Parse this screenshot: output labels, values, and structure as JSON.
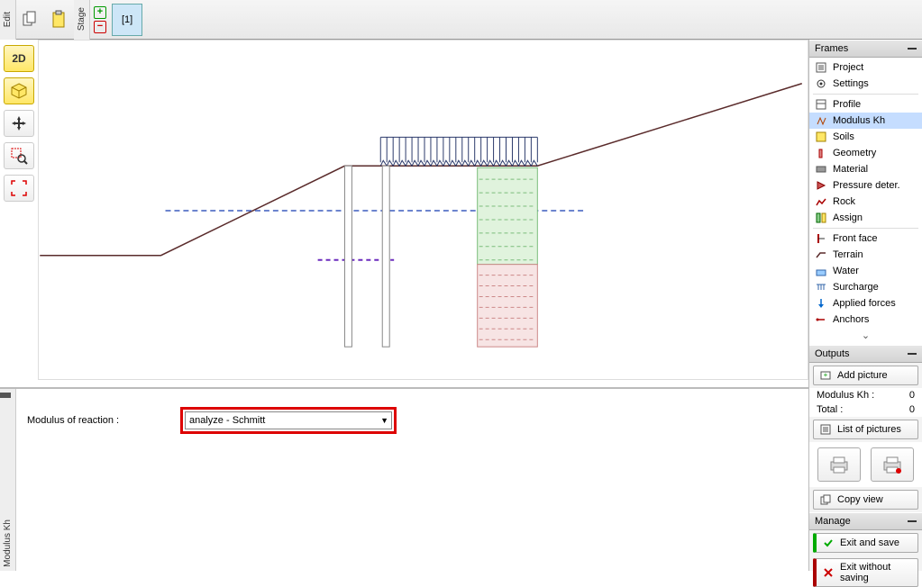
{
  "toolbar": {
    "edit_label": "Edit",
    "stage_label": "Stage",
    "stage_tab": "[1]"
  },
  "left_tools": {
    "btn_2d": "2D",
    "btn_3d": "3D"
  },
  "bottom": {
    "panel_label": "Modulus Kh",
    "field_label": "Modulus of reaction :",
    "select_value": "analyze - Schmitt"
  },
  "right": {
    "frames_header": "Frames",
    "items_a": [
      {
        "label": "Project",
        "icon": "project"
      },
      {
        "label": "Settings",
        "icon": "gear"
      }
    ],
    "items_b": [
      {
        "label": "Profile",
        "icon": "profile"
      },
      {
        "label": "Modulus Kh",
        "icon": "modulus",
        "selected": true
      },
      {
        "label": "Soils",
        "icon": "soils"
      },
      {
        "label": "Geometry",
        "icon": "geometry"
      },
      {
        "label": "Material",
        "icon": "material"
      },
      {
        "label": "Pressure deter.",
        "icon": "pressure"
      },
      {
        "label": "Rock",
        "icon": "rock"
      },
      {
        "label": "Assign",
        "icon": "assign"
      }
    ],
    "items_c": [
      {
        "label": "Front face",
        "icon": "front"
      },
      {
        "label": "Terrain",
        "icon": "terrain"
      },
      {
        "label": "Water",
        "icon": "water"
      },
      {
        "label": "Surcharge",
        "icon": "surcharge"
      },
      {
        "label": "Applied forces",
        "icon": "forces"
      },
      {
        "label": "Anchors",
        "icon": "anchors"
      }
    ],
    "outputs_header": "Outputs",
    "add_picture": "Add picture",
    "stat1_label": "Modulus Kh :",
    "stat1_val": "0",
    "stat2_label": "Total :",
    "stat2_val": "0",
    "list_pictures": "List of pictures",
    "copy_view": "Copy view",
    "manage_header": "Manage",
    "exit_save": "Exit and save",
    "exit_nosave": "Exit without saving"
  }
}
